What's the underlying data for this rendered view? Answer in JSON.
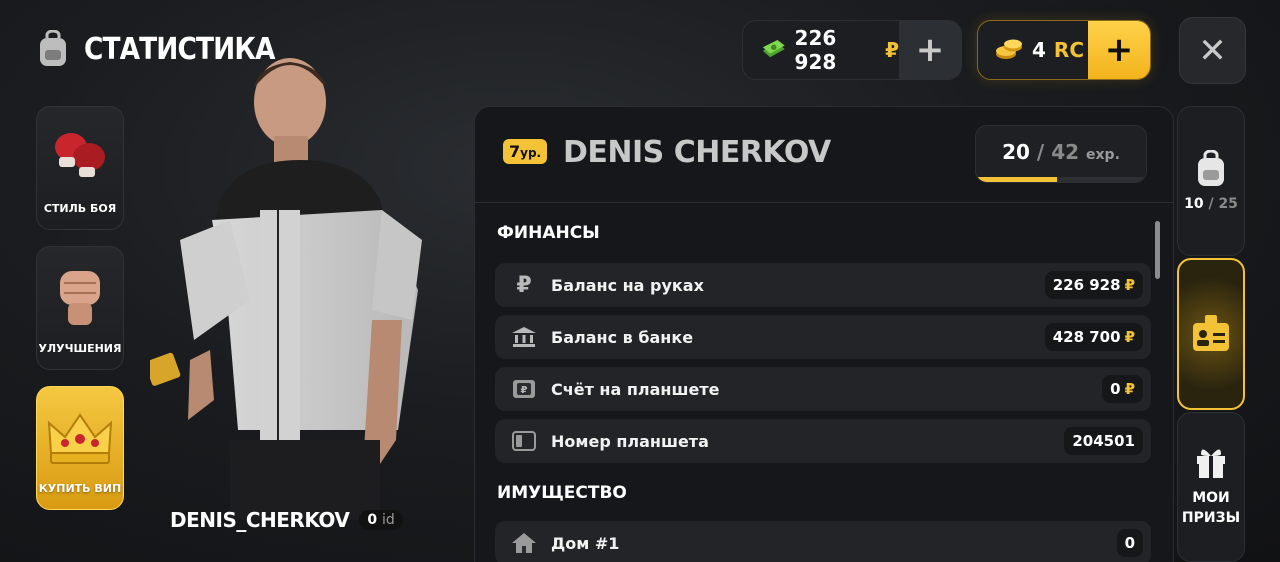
{
  "header": {
    "title": "СТАТИСТИКА"
  },
  "currency": {
    "money": "226 928",
    "money_symbol": "₽",
    "rc_amount": "4",
    "rc_label": "RC",
    "plus": "+",
    "close": "✕"
  },
  "left_menu": [
    {
      "label": "СТИЛЬ БОЯ"
    },
    {
      "label": "УЛУЧШЕНИЯ"
    },
    {
      "label": "КУПИТЬ ВИП"
    }
  ],
  "player": {
    "name": "DENIS_CHERKOV",
    "id_value": "0",
    "id_label": "id"
  },
  "profile": {
    "level_num": "7",
    "level_suffix": "ур.",
    "name": "DENIS CHERKOV",
    "exp_current": "20",
    "exp_sep": "/",
    "exp_max": "42",
    "exp_unit": "exp.",
    "exp_fraction": 0.476
  },
  "finances": {
    "title": "ФИНАНСЫ",
    "rows": [
      {
        "icon": "ruble-icon",
        "label": "Баланс на руках",
        "value": "226 928",
        "suffix": "₽"
      },
      {
        "icon": "bank-icon",
        "label": "Баланс в банке",
        "value": "428 700",
        "suffix": "₽"
      },
      {
        "icon": "tablet-account-icon",
        "label": "Счёт на планшете",
        "value": "0",
        "suffix": "₽"
      },
      {
        "icon": "tablet-icon",
        "label": "Номер планшета",
        "value": "204501",
        "suffix": ""
      }
    ]
  },
  "property": {
    "title": "ИМУЩЕСТВО",
    "rows": [
      {
        "icon": "house-icon",
        "label": "Дом #1",
        "value": "0"
      }
    ]
  },
  "right_tabs": {
    "inventory_count": "10",
    "inventory_sep": "/",
    "inventory_max": "25",
    "prizes_line1": "МОИ",
    "prizes_line2": "ПРИЗЫ"
  },
  "colors": {
    "accent": "#f3c237",
    "money_green": "#5fbf3a",
    "panel": "#15171a"
  }
}
